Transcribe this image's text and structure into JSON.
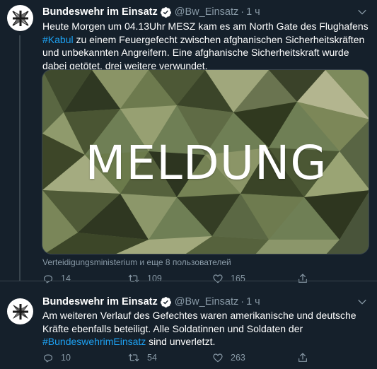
{
  "tweets": [
    {
      "name": "Bundeswehr im Einsatz",
      "handle": "@Bw_Einsatz",
      "separator": "·",
      "time": "1 ч",
      "text_before": "Heute Morgen um 04.13Uhr MESZ kam es am North Gate des Flughafens ",
      "hashtag": "#Kabul",
      "text_after": " zu einem Feuergefecht zwischen afghanischen Sicherheitskräften und unbekannten Angreifern. Eine afghanische Sicherheitskraft wurde dabei getötet, drei weitere verwundet.",
      "media": {
        "headline": "MELDUNG"
      },
      "tagged": "Verteidigungsministerium и еще 8 пользователей",
      "replies": "14",
      "retweets": "109",
      "likes": "165"
    },
    {
      "name": "Bundeswehr im Einsatz",
      "handle": "@Bw_Einsatz",
      "separator": "·",
      "time": "1 ч",
      "text_before": "Am weiteren Verlauf des Gefechtes waren amerikanische und deutsche Kräfte ebenfalls beteiligt. Alle Soldatinnen und Soldaten der ",
      "hashtag": "#BundeswehrimEinsatz",
      "text_after": " sind unverletzt.",
      "replies": "10",
      "retweets": "54",
      "likes": "263"
    }
  ],
  "colors": {
    "background": "#15202b",
    "text_primary": "#ffffff",
    "text_secondary": "#8899a6",
    "link": "#1da1f2",
    "divider": "#38444d"
  },
  "icons": {
    "avatar": "iron-cross-icon",
    "verified": "verified-badge-icon",
    "more": "chevron-down-icon",
    "reply": "reply-icon",
    "retweet": "retweet-icon",
    "like": "heart-icon"
  }
}
